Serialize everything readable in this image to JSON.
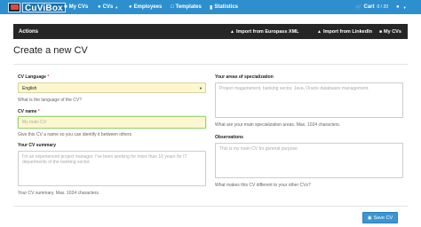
{
  "navbar": {
    "brand": "CuViBox",
    "items": [
      {
        "label": "My CVs",
        "icon": "folder-icon"
      },
      {
        "label": "CVs",
        "icon": "people-icon"
      },
      {
        "label": "Employees",
        "icon": "user-icon"
      },
      {
        "label": "Templates",
        "icon": "file-icon"
      },
      {
        "label": "Statistics",
        "icon": "bar-chart-icon"
      }
    ],
    "cart": {
      "label": "Cart",
      "count": "0 / 20"
    },
    "accent_color": "#2e8fcf"
  },
  "actions": {
    "title": "Actions",
    "links": [
      {
        "label": "Import from Europass XML",
        "icon": "upload-icon"
      },
      {
        "label": "Import from LinkedIn",
        "icon": "upload-icon"
      },
      {
        "label": "My CVs",
        "icon": "folder-icon"
      }
    ]
  },
  "page_title": "Create a new CV",
  "form": {
    "language": {
      "label": "CV Language",
      "required_mark": "*",
      "selected": "English",
      "help": "What is the language of the CV?"
    },
    "name": {
      "label": "CV name",
      "required_mark": "*",
      "placeholder": "My main CV",
      "help": "Give this CV a name so you can identify it between others"
    },
    "summary": {
      "label": "Your CV summary",
      "placeholder": "I'm an experienced project manager. I've been working for more than 10 years for IT departments of the banking sector.",
      "help": "Your CV summary. Max. 1024 characters."
    },
    "specialization": {
      "label": "Your areas of specialization",
      "placeholder": "Project magamenent, banking sector, Java, Oracle databases management.",
      "help": "What are your main specialization areas. Max. 1024 characters."
    },
    "observations": {
      "label": "Observations",
      "placeholder": "This is my main CV for general purpose",
      "help": "What makes this CV different to your other CVs?"
    }
  },
  "save_button": {
    "label": "Save CV",
    "icon": "save-icon"
  }
}
